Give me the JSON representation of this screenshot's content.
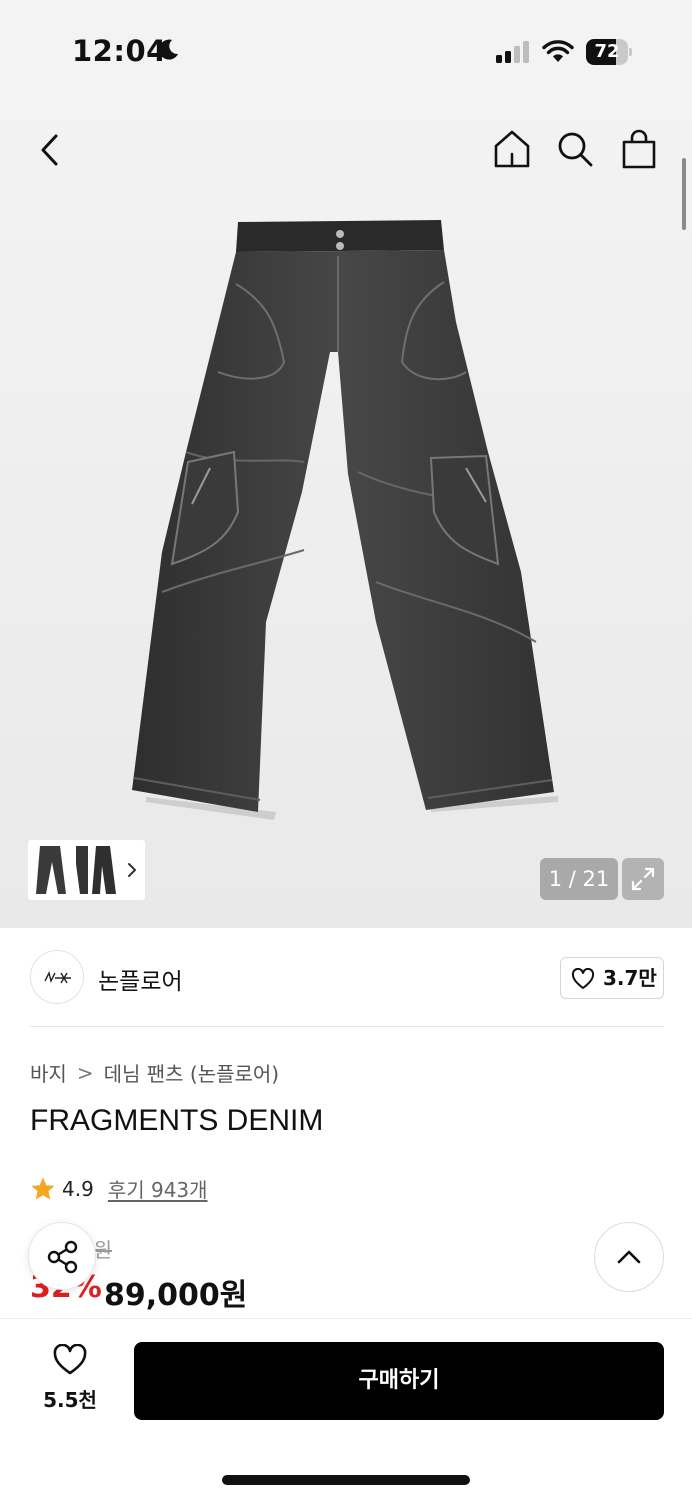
{
  "status_bar": {
    "time": "12:04",
    "battery": "72",
    "battery_level": 0.72,
    "icons": [
      "moon-icon",
      "cellular-signal-icon",
      "wifi-icon",
      "battery-icon"
    ]
  },
  "nav": {
    "icons": [
      "back-chevron-icon",
      "home-icon",
      "search-icon",
      "shopping-bag-icon"
    ]
  },
  "gallery": {
    "counter": "1 / 21",
    "current": 1,
    "total": 21
  },
  "brand": {
    "name": "논플로어",
    "like_count": "3.7만"
  },
  "breadcrumb": {
    "items": [
      "바지",
      "데님 팬츠 (논플로어)"
    ],
    "separator": ">"
  },
  "product": {
    "title": "FRAGMENTS DENIM",
    "rating": "4.9",
    "review_label": "후기 943개",
    "original_price": "1    00원",
    "discount": "32%",
    "price": "89,000원"
  },
  "bottom_bar": {
    "like_count": "5.5천",
    "buy_label": "구매하기"
  },
  "colors": {
    "discount": "#e02020",
    "buy_button": "#000000",
    "star": "#f6a623",
    "denim": "#3c3c3c"
  }
}
